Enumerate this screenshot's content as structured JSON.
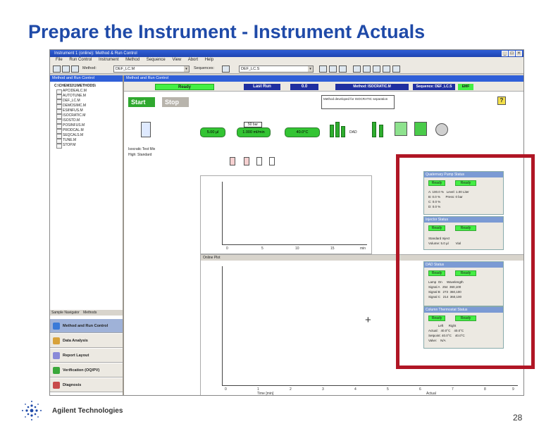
{
  "slide": {
    "title": "Prepare the Instrument - Instrument Actuals",
    "brand": "Agilent Technologies",
    "page_number": "28"
  },
  "window": {
    "title": "Instrument 1 (online): Method & Run Control",
    "menu": [
      "File",
      "Run Control",
      "Instrument",
      "Method",
      "Sequence",
      "View",
      "Abort",
      "Help"
    ],
    "toolbar": {
      "method_label": "Method:",
      "method_value": "DEF_LC.M",
      "sequence_label": "Sequences:",
      "sequence_value": "DEF_LC.S"
    }
  },
  "nav": {
    "header": "Method and Run Control",
    "tree_root": "C:\\CHEM32\\1\\METHODS\\",
    "tree_items": [
      "APCIDEALC.M",
      "AUTOTUNE.M",
      "DEF_LC.M",
      "DEMOSIMC.M",
      "ESIINFUS.M",
      "ISOCRATIC.M",
      "ISOSTD.M",
      "POSINFUS.M",
      "PRODCAL.M",
      "SEQCALS.M",
      "TUNE.M",
      "STOP.M"
    ],
    "tabs": [
      "Sample Navigator",
      "Methods"
    ],
    "buttons": [
      "Method and Run Control",
      "Data Analysis",
      "Report Layout",
      "Verification (OQ/PV)",
      "Diagnosis"
    ]
  },
  "content": {
    "header": "Method and Run Control",
    "status_ready": "Ready",
    "status_last_run": "Last Run",
    "status_counter": "0.0",
    "method_status": "Method: ISOCRATIC.M",
    "sequence_status": "Sequence: DEF_LC.S",
    "start_label": "Start",
    "stop_label": "Stop",
    "method_info": "Method developed for ISOCRATIC separation",
    "pressure": "50 bar",
    "volume": "5.00 µl",
    "flow": "1.000 ml/min",
    "temperature": "40.0°C",
    "dad_label": "DAD",
    "sample_label": "Isocratic Test Mix",
    "sample_sub": "High: Standard",
    "plot_label": "Online Plot",
    "plot_x_label": "Time [min]",
    "plot_x_ticks": [
      "0",
      "5",
      "10",
      "15",
      "min"
    ],
    "plot_bottom_ticks": [
      "0",
      "1",
      "2",
      "3",
      "4",
      "5",
      "6",
      "7",
      "8",
      "9"
    ],
    "actuals_label": "Actual"
  },
  "status_panels": {
    "pump": {
      "title": "Quaternary Pump Status",
      "state1": "Ready",
      "state2": "Ready",
      "lines": [
        "A: 100.0 %   Level: 1.00 Liter",
        "B: 0.0 %      Press: 0 bar",
        "C: 0.0 %",
        "D: 0.0 %"
      ]
    },
    "injector": {
      "title": "Injector Status",
      "state1": "Ready",
      "state2": "Ready",
      "lines": [
        "Standard Inject",
        "Volume: 5.0 µl        Vial"
      ]
    },
    "dad": {
      "title": "DAD Status",
      "state1": "Ready",
      "state2": "Ready",
      "lines": [
        "Lamp  On     Wavelength",
        "Signal A   254  360,100",
        "Signal B   273  360,100",
        "Signal C   214  360,100"
      ]
    },
    "column": {
      "title": "Column Thermostat Status",
      "state1": "Ready",
      "state2": "Ready",
      "lines": [
        "           Left      Right",
        "Actual:   40.0°C    40.0°C",
        "Setpoint: 40.0°C    40.0°C",
        "Valve:    N/A"
      ]
    }
  },
  "colors": {
    "title_blue": "#1f4aa8",
    "highlight_red": "#b01625",
    "ready_green": "#44ee44",
    "window_blue": "#2f5fd8"
  }
}
